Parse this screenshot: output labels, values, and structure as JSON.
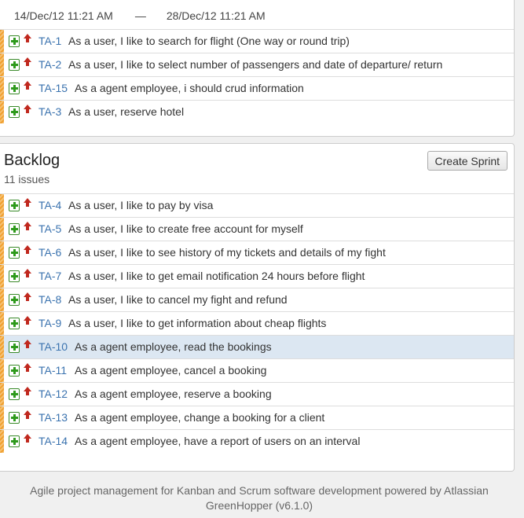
{
  "sprint": {
    "start_date": "14/Dec/12 11:21 AM",
    "separator": "—",
    "end_date": "28/Dec/12 11:21 AM",
    "issues": [
      {
        "key": "TA-1",
        "summary": "As a user, I like to search for flight (One way or round trip)"
      },
      {
        "key": "TA-2",
        "summary": "As a user, I like to select number of passengers and date of departure/ return"
      },
      {
        "key": "TA-15",
        "summary": "As a agent employee, i should crud information"
      },
      {
        "key": "TA-3",
        "summary": "As a user, reserve hotel"
      }
    ]
  },
  "backlog": {
    "title": "Backlog",
    "count": "11 issues",
    "create_sprint_label": "Create Sprint",
    "issues": [
      {
        "key": "TA-4",
        "summary": "As a user, I like to pay by visa"
      },
      {
        "key": "TA-5",
        "summary": "As a user, I like to create free account for myself"
      },
      {
        "key": "TA-6",
        "summary": "As a user, I like to see history of my tickets and details of my fight"
      },
      {
        "key": "TA-7",
        "summary": "As a user, I like to get email notification 24 hours before flight"
      },
      {
        "key": "TA-8",
        "summary": "As a user, I like to cancel my fight and refund"
      },
      {
        "key": "TA-9",
        "summary": "As a user, I like to get information about cheap flights"
      },
      {
        "key": "TA-10",
        "summary": "As a agent employee, read the bookings",
        "selected": true
      },
      {
        "key": "TA-11",
        "summary": "As a agent employee, cancel a booking"
      },
      {
        "key": "TA-12",
        "summary": "As a agent employee, reserve a booking"
      },
      {
        "key": "TA-13",
        "summary": "As a agent employee, change a booking for a client"
      },
      {
        "key": "TA-14",
        "summary": "As a agent employee, have a report of users on an interval"
      }
    ]
  },
  "icons": {
    "issue_type": "story-icon",
    "priority": "priority-major-icon"
  },
  "colors": {
    "link": "#3b73af",
    "selected_row": "#dce7f2",
    "grabber": "#f0a030",
    "priority": "#c0281e",
    "story": "#2e9a1c"
  },
  "footer": {
    "line1": "Agile project management for Kanban and Scrum software development powered by Atlassian",
    "line2": "GreenHopper (v6.1.0)"
  }
}
